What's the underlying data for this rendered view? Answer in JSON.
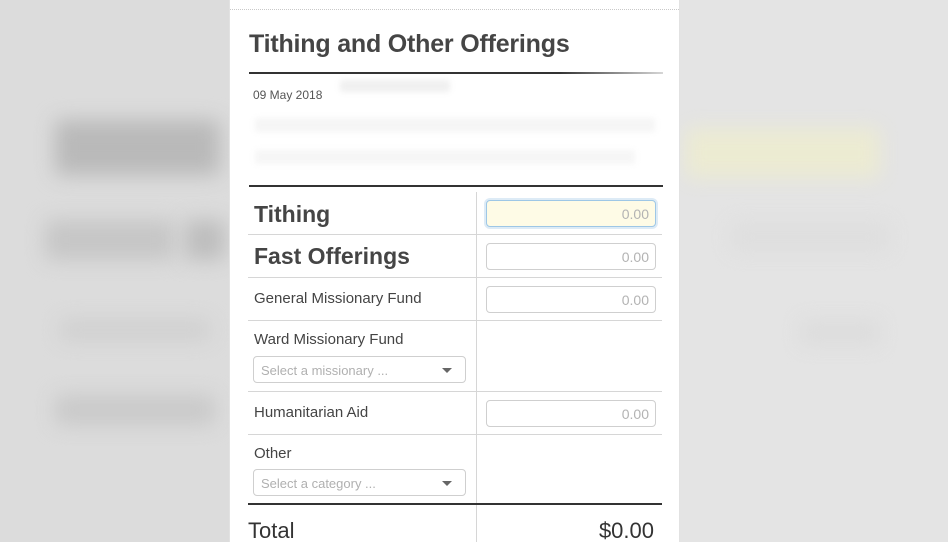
{
  "page": {
    "title": "Tithing and Other Offerings",
    "date": "09 May 2018"
  },
  "rows": [
    {
      "label": "Tithing",
      "kind": "amount",
      "placeholder": "0.00",
      "focused": true
    },
    {
      "label": "Fast Offerings",
      "kind": "amount",
      "placeholder": "0.00"
    },
    {
      "label": "General Missionary Fund",
      "kind": "amount",
      "placeholder": "0.00"
    },
    {
      "label": "Ward Missionary Fund",
      "kind": "select",
      "select_placeholder": "Select a missionary ..."
    },
    {
      "label": "Humanitarian Aid",
      "kind": "amount",
      "placeholder": "0.00"
    },
    {
      "label": "Other",
      "kind": "select",
      "select_placeholder": "Select a category ..."
    }
  ],
  "total": {
    "label": "Total",
    "value": "$0.00"
  },
  "colors": {
    "focus_fill": "#fefbe6",
    "focus_border": "#9ec7e6",
    "rule": "#333333"
  },
  "icons": {
    "select_caret": "chevron-down-icon"
  }
}
